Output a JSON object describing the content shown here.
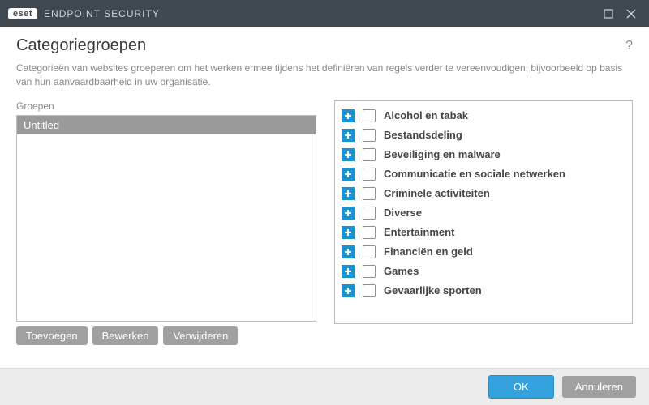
{
  "titlebar": {
    "brand_badge": "eset",
    "brand_text": "ENDPOINT SECURITY"
  },
  "heading": "Categoriegroepen",
  "help_char": "?",
  "subtitle": "Categorieën van websites groeperen om het werken ermee tijdens het definiëren van regels verder te vereenvoudigen, bijvoorbeeld op basis van hun aanvaardbaarheid in uw organisatie.",
  "groups_label": "Groepen",
  "groups": {
    "items": [
      "Untitled"
    ]
  },
  "group_buttons": {
    "add": "Toevoegen",
    "edit": "Bewerken",
    "delete": "Verwijderen"
  },
  "categories": {
    "items": [
      "Alcohol en tabak",
      "Bestandsdeling",
      "Beveiliging en malware",
      "Communicatie en sociale netwerken",
      "Criminele activiteiten",
      "Diverse",
      "Entertainment",
      "Financiën en geld",
      "Games",
      "Gevaarlijke sporten"
    ]
  },
  "footer": {
    "ok": "OK",
    "cancel": "Annuleren"
  }
}
